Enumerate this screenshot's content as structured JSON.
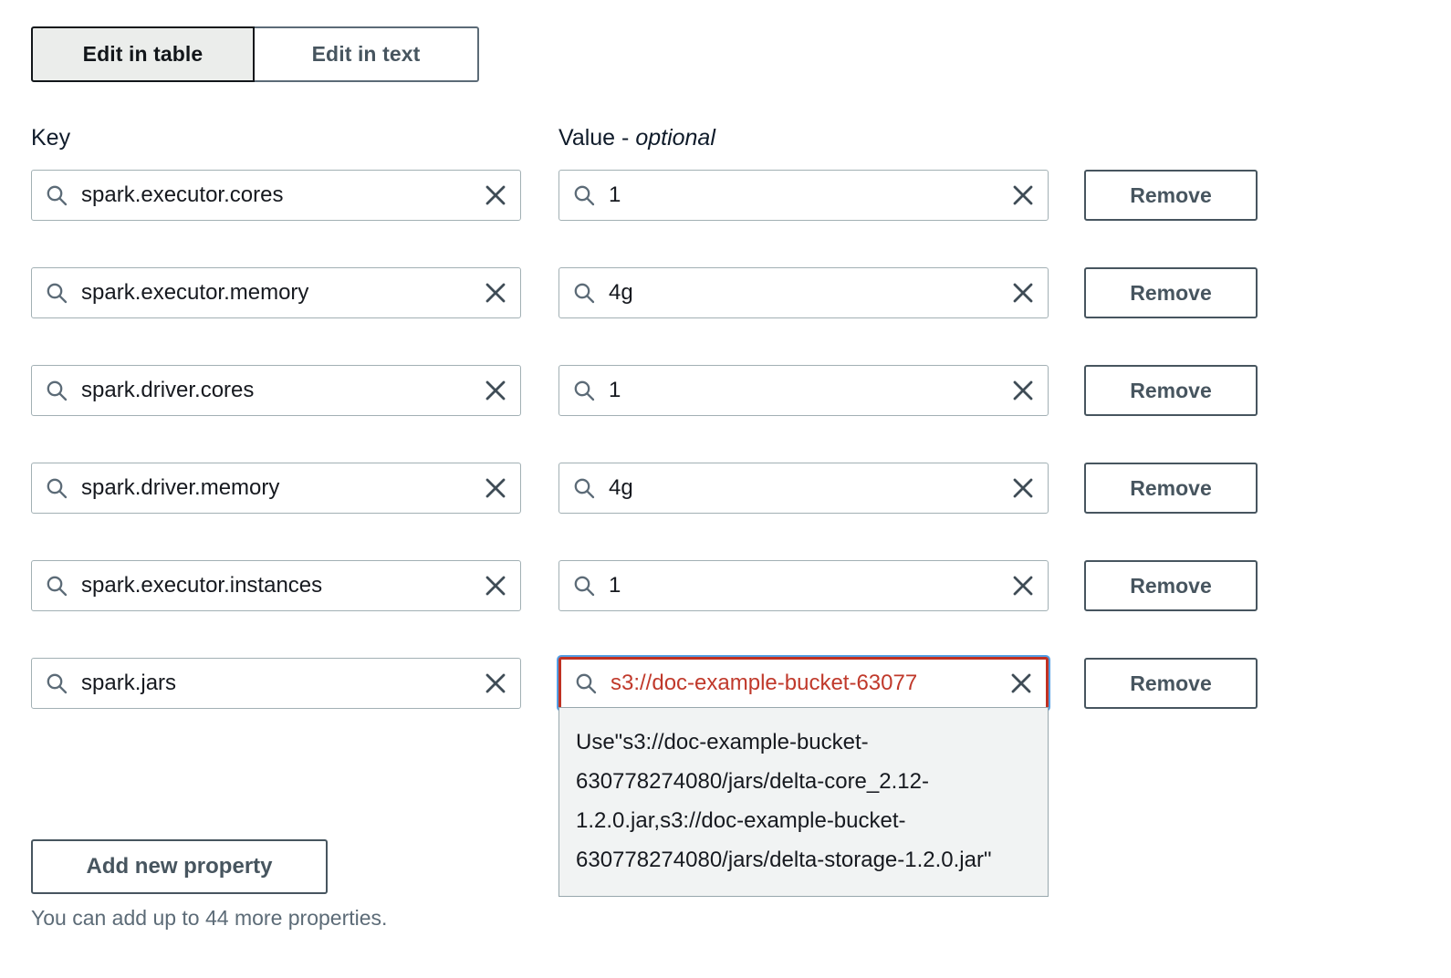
{
  "segmented_control": {
    "options": [
      {
        "label": "Edit in table",
        "selected": true
      },
      {
        "label": "Edit in text",
        "selected": false
      }
    ]
  },
  "columns": {
    "key_label": "Key",
    "value_label": "Value - ",
    "value_optional_suffix": "optional"
  },
  "icons": {
    "search": "search-icon",
    "clear": "close-icon"
  },
  "rows": [
    {
      "key": "spark.executor.cores",
      "value": "1",
      "remove_label": "Remove",
      "error": false
    },
    {
      "key": "spark.executor.memory",
      "value": "4g",
      "remove_label": "Remove",
      "error": false
    },
    {
      "key": "spark.driver.cores",
      "value": "1",
      "remove_label": "Remove",
      "error": false
    },
    {
      "key": "spark.driver.memory",
      "value": "4g",
      "remove_label": "Remove",
      "error": false
    },
    {
      "key": "spark.executor.instances",
      "value": "1",
      "remove_label": "Remove",
      "error": false
    },
    {
      "key": "spark.jars",
      "value": "s3://doc-example-bucket-63077",
      "remove_label": "Remove",
      "error": true
    }
  ],
  "suggestion_dropdown": {
    "text": "Use\"s3://doc-example-bucket-630778274080/jars/delta-core_2.12-1.2.0.jar,s3://doc-example-bucket-630778274080/jars/delta-storage-1.2.0.jar\""
  },
  "footer": {
    "add_button_label": "Add new property",
    "hint": "You can add up to 44 more properties."
  },
  "colors": {
    "error_border": "#c03122",
    "error_text": "#c0392b",
    "focus_ring": "#539fe5",
    "border_default": "#a2b0b4",
    "button_border": "#47555f",
    "dropdown_bg": "#f1f3f3"
  }
}
